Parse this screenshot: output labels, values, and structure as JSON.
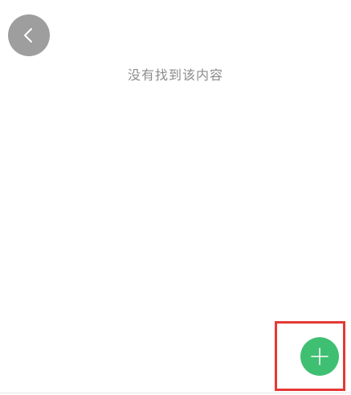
{
  "empty_state": {
    "message": "没有找到该内容"
  },
  "icons": {
    "back": "chevron-left-icon",
    "add": "plus-icon"
  },
  "colors": {
    "back_button_bg": "#9e9e9e",
    "fab_bg": "#3fbf72",
    "highlight_border": "#e53935",
    "message_text": "#8c8c8c"
  }
}
